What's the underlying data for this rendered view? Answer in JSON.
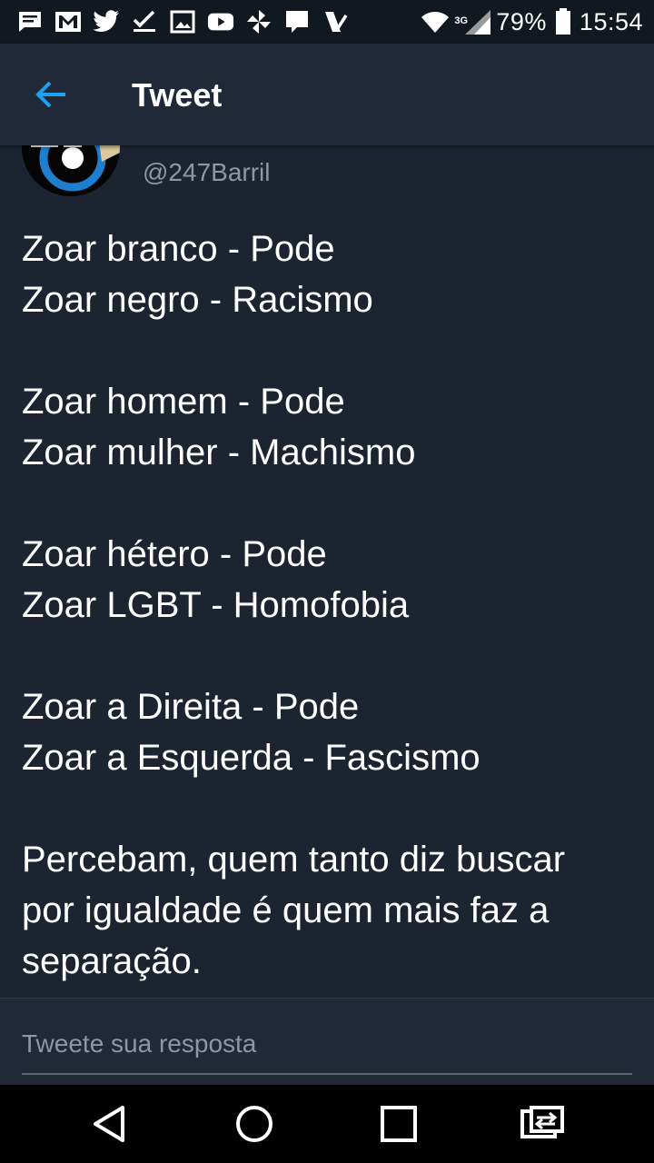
{
  "status_bar": {
    "network_label": "3G",
    "battery_percent": "79%",
    "time": "15:54",
    "notification_icons": [
      "message-icon",
      "gmail-icon",
      "twitter-icon",
      "check-icon",
      "image-icon",
      "youtube-icon",
      "pinwheel-icon",
      "chat-bubble-icon",
      "task-check-icon"
    ]
  },
  "app_bar": {
    "title": "Tweet",
    "back_icon": "arrow-left-icon"
  },
  "tweet": {
    "handle": "@247Barril",
    "lines": [
      "Zoar branco - Pode",
      "Zoar negro - Racismo",
      "",
      "Zoar homem - Pode",
      "Zoar mulher - Machismo",
      "",
      "Zoar hétero - Pode",
      "Zoar LGBT - Homofobia",
      "",
      "Zoar a Direita - Pode",
      "Zoar a Esquerda - Fascismo",
      "",
      "Percebam, quem tanto diz buscar",
      "por igualdade é quem mais faz a",
      "separação."
    ]
  },
  "reply": {
    "placeholder": "Tweete sua resposta"
  },
  "colors": {
    "background": "#1b2430",
    "app_bar": "#1f2937",
    "accent_blue": "#1da1f2",
    "muted_text": "#8b98a5"
  }
}
